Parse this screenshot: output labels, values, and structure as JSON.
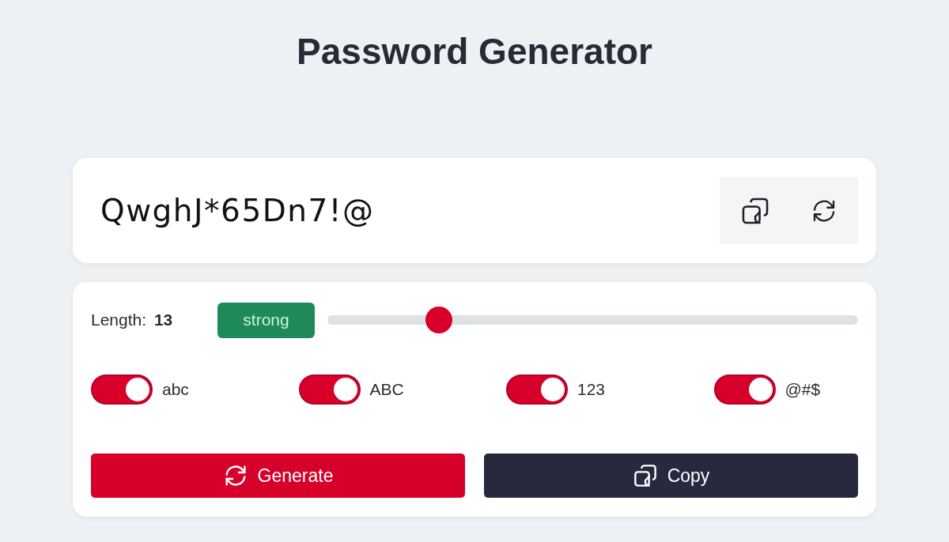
{
  "title": "Password Generator",
  "password": {
    "value": "QwghJ*65Dn7!@"
  },
  "length": {
    "label": "Length:",
    "value": "13",
    "strength": "strong",
    "level": 0.21
  },
  "options": [
    {
      "label": "abc",
      "on": true
    },
    {
      "label": "ABC",
      "on": true
    },
    {
      "label": "123",
      "on": true
    },
    {
      "label": "@#$",
      "on": true
    }
  ],
  "buttons": [
    {
      "label": "Generate",
      "kind": "generate"
    },
    {
      "label": "Copy",
      "kind": "copy"
    }
  ]
}
